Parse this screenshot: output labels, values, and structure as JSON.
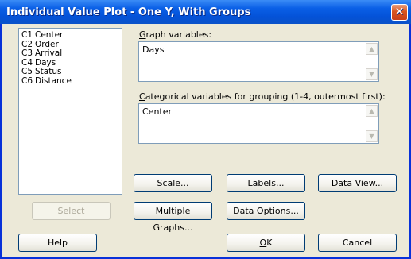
{
  "window": {
    "title": "Individual Value Plot - One Y, With Groups",
    "close_symbol": "✕"
  },
  "variables": [
    {
      "id": "C1",
      "name": "Center"
    },
    {
      "id": "C2",
      "name": "Order"
    },
    {
      "id": "C3",
      "name": "Arrival"
    },
    {
      "id": "C4",
      "name": "Days"
    },
    {
      "id": "C5",
      "name": "Status"
    },
    {
      "id": "C6",
      "name": "Distance"
    }
  ],
  "graph_variables": {
    "label_mnemonic": "G",
    "label_rest": "raph variables:",
    "value": "Days"
  },
  "categorical": {
    "label_mnemonic": "C",
    "label_rest": "ategorical variables for grouping (1-4, outermost first):",
    "value": "Center"
  },
  "buttons": {
    "scale": {
      "m": "S",
      "rest": "cale..."
    },
    "labels": {
      "m": "L",
      "rest": "abels..."
    },
    "data_view": {
      "pre": "",
      "m": "D",
      "rest": "ata View..."
    },
    "select": "Select",
    "multiple_graphs": {
      "m": "M",
      "rest": "ultiple Graphs..."
    },
    "data_options": {
      "pre": "Dat",
      "m": "a",
      "rest": " Options..."
    },
    "help": "Help",
    "ok": {
      "m": "O",
      "rest": "K"
    },
    "cancel": "Cancel"
  },
  "scroll": {
    "up": "▲",
    "down": "▼"
  }
}
